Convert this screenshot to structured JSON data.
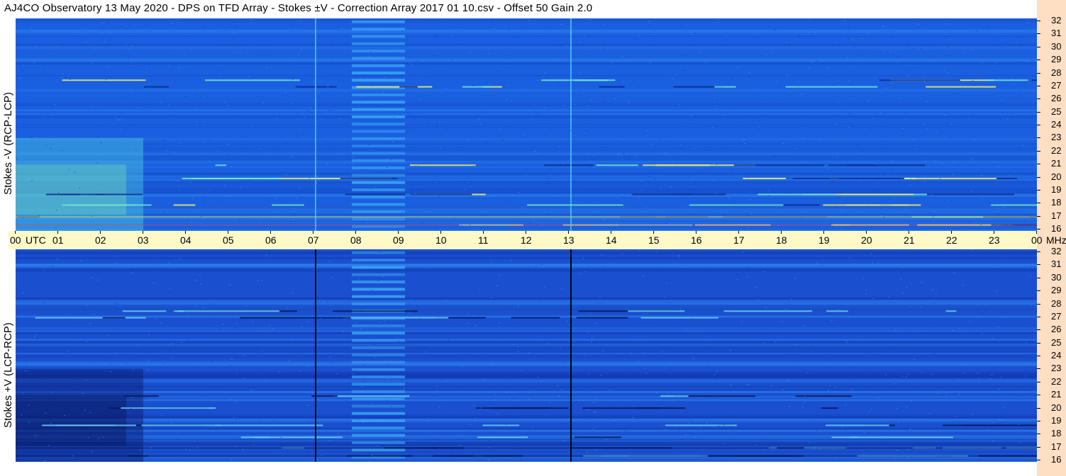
{
  "title": "AJ4CO Observatory  13 May 2020  -  DPS on TFD Array  -  Stokes ±V  -  Correction Array 2017 01 10.csv  -  Offset 50  Gain 2.0",
  "colors": {
    "background_top": "#1a5fe0",
    "background_bottom": "#1a50d0",
    "time_band": "#fff9c8",
    "freq_strip": "#ffdfc4"
  },
  "chart_data": [
    {
      "type": "heatmap",
      "ylabel": "Stokes -V (RCP-LCP)",
      "x_unit": "UTC",
      "y_unit": "MHz",
      "xlim": [
        0,
        24
      ],
      "ylim": [
        16,
        32
      ],
      "x_ticks": [
        "00",
        "01",
        "02",
        "03",
        "04",
        "05",
        "06",
        "07",
        "08",
        "09",
        "10",
        "11",
        "12",
        "13",
        "14",
        "15",
        "16",
        "17",
        "18",
        "19",
        "20",
        "21",
        "22",
        "23",
        "00"
      ],
      "y_ticks": [
        "16",
        "17",
        "18",
        "19",
        "20",
        "21",
        "22",
        "23",
        "24",
        "25",
        "26",
        "27",
        "28",
        "29",
        "30",
        "31",
        "32"
      ],
      "vertical_lines_utc": [
        7.05,
        13.05
      ],
      "striped_block_utc": [
        7.9,
        9.15
      ],
      "interference_freqs_mhz": [
        16.5,
        17.1,
        18.0,
        18.8,
        20.0,
        21.0,
        26.9,
        27.4
      ]
    },
    {
      "type": "heatmap",
      "ylabel": "Stokes +V (LCP-RCP)",
      "x_unit": "UTC",
      "y_unit": "MHz",
      "xlim": [
        0,
        24
      ],
      "ylim": [
        16,
        32
      ],
      "x_ticks": [
        "00",
        "01",
        "02",
        "03",
        "04",
        "05",
        "06",
        "07",
        "08",
        "09",
        "10",
        "11",
        "12",
        "13",
        "14",
        "15",
        "16",
        "17",
        "18",
        "19",
        "20",
        "21",
        "22",
        "23",
        "00"
      ],
      "y_ticks": [
        "16",
        "17",
        "18",
        "19",
        "20",
        "21",
        "22",
        "23",
        "24",
        "25",
        "26",
        "27",
        "28",
        "29",
        "30",
        "31",
        "32"
      ],
      "vertical_lines_utc": [
        7.05,
        13.05
      ],
      "striped_block_utc": [
        7.9,
        9.15
      ],
      "interference_freqs_mhz": [
        16.5,
        17.1,
        17.9,
        18.8,
        20.1,
        21.0,
        26.9,
        27.4
      ]
    }
  ],
  "time_axis": {
    "utc_label": "UTC",
    "mhz_label": "MHz"
  }
}
